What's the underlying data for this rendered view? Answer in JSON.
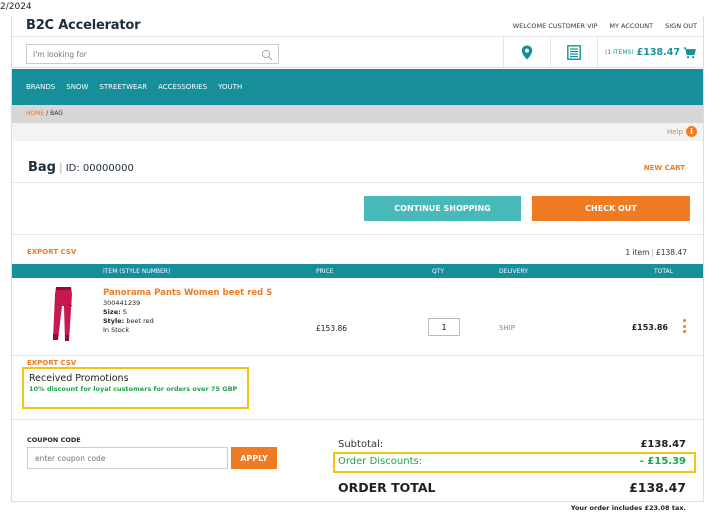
{
  "browser": {
    "date_fragment": "2/2024"
  },
  "header": {
    "logo": "B2C Accelerator",
    "links": [
      "WELCOME CUSTOMER VIP",
      "MY ACCOUNT",
      "SIGN OUT"
    ],
    "search_placeholder": "I'm looking for",
    "cart_count": "(1 ITEMS)",
    "cart_total": "£138.47"
  },
  "nav": {
    "items": [
      "BRANDS",
      "SNOW",
      "STREETWEAR",
      "ACCESSORIES",
      "YOUTH"
    ]
  },
  "breadcrumb": {
    "home": "HOME",
    "separator": "/",
    "current": "BAG"
  },
  "help": {
    "label": "Help"
  },
  "bag": {
    "title": "Bag",
    "id_label": "ID: 00000000",
    "new_cart": "NEW CART",
    "continue_label": "CONTINUE SHOPPING",
    "checkout_label": "CHECK OUT",
    "export_label": "EXPORT CSV",
    "item_count": "1 item",
    "item_total": "£138.47"
  },
  "table": {
    "headers": {
      "item": "ITEM (STYLE NUMBER)",
      "price": "PRICE",
      "qty": "QTY",
      "delivery": "DELIVERY",
      "total": "TOTAL"
    },
    "rows": [
      {
        "name": "Panorama Pants Women beet red S",
        "style_number": "300441239",
        "size_label": "Size:",
        "size": "S",
        "style_label": "Style:",
        "style": "beet red",
        "stock": "In Stock",
        "price": "£153.86",
        "qty": "1",
        "delivery": "SHIP",
        "total": "£153.86"
      }
    ]
  },
  "promotions": {
    "export_label": "EXPORT CSV",
    "title": "Received Promotions",
    "text": "10% discount for loyal customers for orders over 75 GBP"
  },
  "coupon": {
    "label": "COUPON CODE",
    "placeholder": "enter coupon code",
    "apply_label": "APPLY"
  },
  "summary": {
    "subtotal_label": "Subtotal:",
    "subtotal": "£138.47",
    "discount_label": "Order Discounts:",
    "discount": "- £15.39",
    "order_total_label": "ORDER TOTAL",
    "order_total": "£138.47",
    "tax_note": "Your order includes £23.08 tax."
  },
  "colors": {
    "teal": "#168f9b",
    "orange": "#ef7b22",
    "highlight": "#f3c512",
    "green": "#22a24a"
  }
}
